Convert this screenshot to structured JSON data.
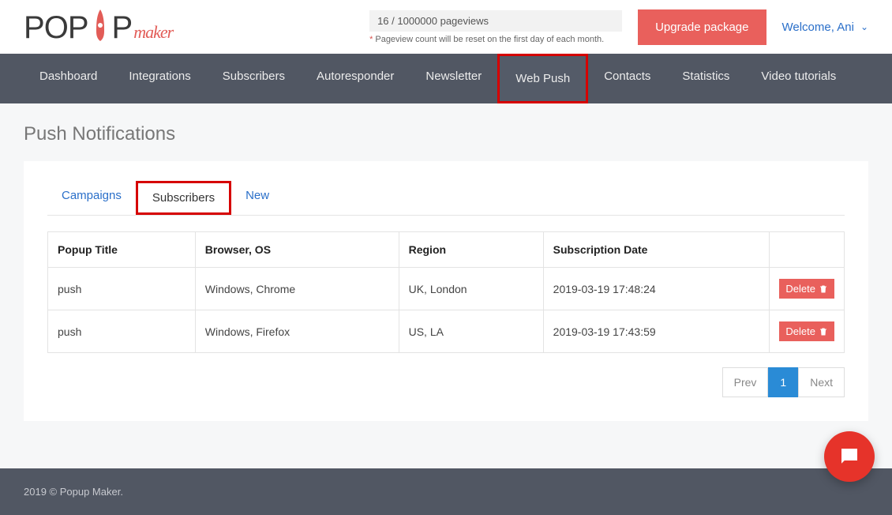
{
  "header": {
    "logo_parts": {
      "p": "P",
      "o": "O",
      "p2": "P",
      "u": "U",
      "p3": "P",
      "maker": "maker"
    },
    "pageviews": "16 / 1000000 pageviews",
    "pageviews_note": "Pageview count will be reset on the first day of each month.",
    "upgrade": "Upgrade package",
    "welcome": "Welcome, Ani"
  },
  "nav": {
    "items": [
      "Dashboard",
      "Integrations",
      "Subscribers",
      "Autoresponder",
      "Newsletter",
      "Web Push",
      "Contacts",
      "Statistics",
      "Video tutorials"
    ],
    "active_index": 5
  },
  "page": {
    "title": "Push Notifications",
    "tabs": [
      "Campaigns",
      "Subscribers",
      "New"
    ],
    "active_tab_index": 1
  },
  "table": {
    "headers": [
      "Popup Title",
      "Browser, OS",
      "Region",
      "Subscription Date"
    ],
    "rows": [
      {
        "title": "push",
        "browser": "Windows, Chrome",
        "region": "UK, London",
        "date": "2019-03-19 17:48:24"
      },
      {
        "title": "push",
        "browser": "Windows, Firefox",
        "region": "US, LA",
        "date": "2019-03-19 17:43:59"
      }
    ],
    "delete_label": "Delete"
  },
  "pager": {
    "prev": "Prev",
    "page": "1",
    "next": "Next"
  },
  "footer": {
    "text": "2019 © Popup Maker."
  }
}
